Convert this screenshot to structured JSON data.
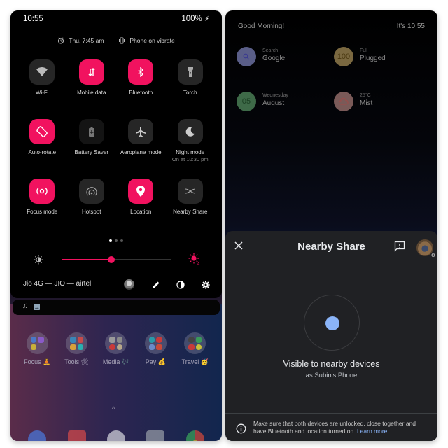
{
  "left_panel": {
    "status_bar": {
      "time": "10:55",
      "battery": "100%",
      "battery_icon": "charging-bolt-icon"
    },
    "info_line": {
      "alarm": "Thu, 7:45 am",
      "ringer": "Phone on vibrate"
    },
    "tiles": [
      {
        "label": "Wi-Fi",
        "sub": "",
        "icon": "wifi-icon",
        "active": false
      },
      {
        "label": "Mobile data",
        "sub": "",
        "icon": "mobile-data-icon",
        "active": true
      },
      {
        "label": "Bluetooth",
        "sub": "",
        "icon": "bluetooth-icon",
        "active": true
      },
      {
        "label": "Torch",
        "sub": "",
        "icon": "torch-icon",
        "active": false
      },
      {
        "label": "Auto-rotate",
        "sub": "",
        "icon": "auto-rotate-icon",
        "active": true
      },
      {
        "label": "Battery Saver",
        "sub": "",
        "icon": "battery-saver-icon",
        "active": false
      },
      {
        "label": "Aeroplane mode",
        "sub": "",
        "icon": "aeroplane-icon",
        "active": false
      },
      {
        "label": "Night mode",
        "sub": "On at 10:30 pm",
        "icon": "moon-icon",
        "active": false
      },
      {
        "label": "Focus mode",
        "sub": "",
        "icon": "focus-mode-icon",
        "active": true
      },
      {
        "label": "Hotspot",
        "sub": "",
        "icon": "hotspot-icon",
        "active": false
      },
      {
        "label": "Location",
        "sub": "",
        "icon": "location-pin-icon",
        "active": true
      },
      {
        "label": "Nearby Share",
        "sub": "",
        "icon": "nearby-share-icon",
        "active": false
      }
    ],
    "page_indicator": {
      "pages": 3,
      "current": 1
    },
    "brightness": {
      "level_fraction": 0.45
    },
    "carrier": "Jio 4G — JIO — airtel",
    "folders": [
      {
        "label": "Focus 🧘"
      },
      {
        "label": "Tools 🛠"
      },
      {
        "label": "Media 🎶"
      },
      {
        "label": "Pay 💰"
      },
      {
        "label": "Travel 🥳"
      }
    ],
    "up_chevron": "^",
    "accent_color": "#f1125f"
  },
  "right_panel": {
    "greeting": "Good Morning!",
    "clock": "It's 10:55",
    "widgets": [
      {
        "badge": "🔍",
        "small": "Search",
        "main": "Google",
        "color": "#6b6f9a",
        "text_color": "#4a4aa0"
      },
      {
        "badge": "100",
        "small": "Full",
        "main": "Plugged",
        "color": "#8a7448",
        "text_color": "#5a4418"
      },
      {
        "badge": "05",
        "small": "Wednesday",
        "main": "August",
        "color": "#4c7a58",
        "text_color": "#1e4a2a"
      },
      {
        "badge": "☁",
        "small": "25°C",
        "main": "Mist",
        "color": "#8a6a68",
        "text_color": "#a04a48"
      }
    ],
    "nearby_share": {
      "title": "Nearby Share",
      "status": "Visible to nearby devices",
      "device_name": "as Subin's Phone",
      "hint": "Make sure that both devices are unlocked, close together and have Bluetooth and location turned on.",
      "learn_more": "Learn more",
      "dot_color": "#8ab4f8"
    }
  }
}
